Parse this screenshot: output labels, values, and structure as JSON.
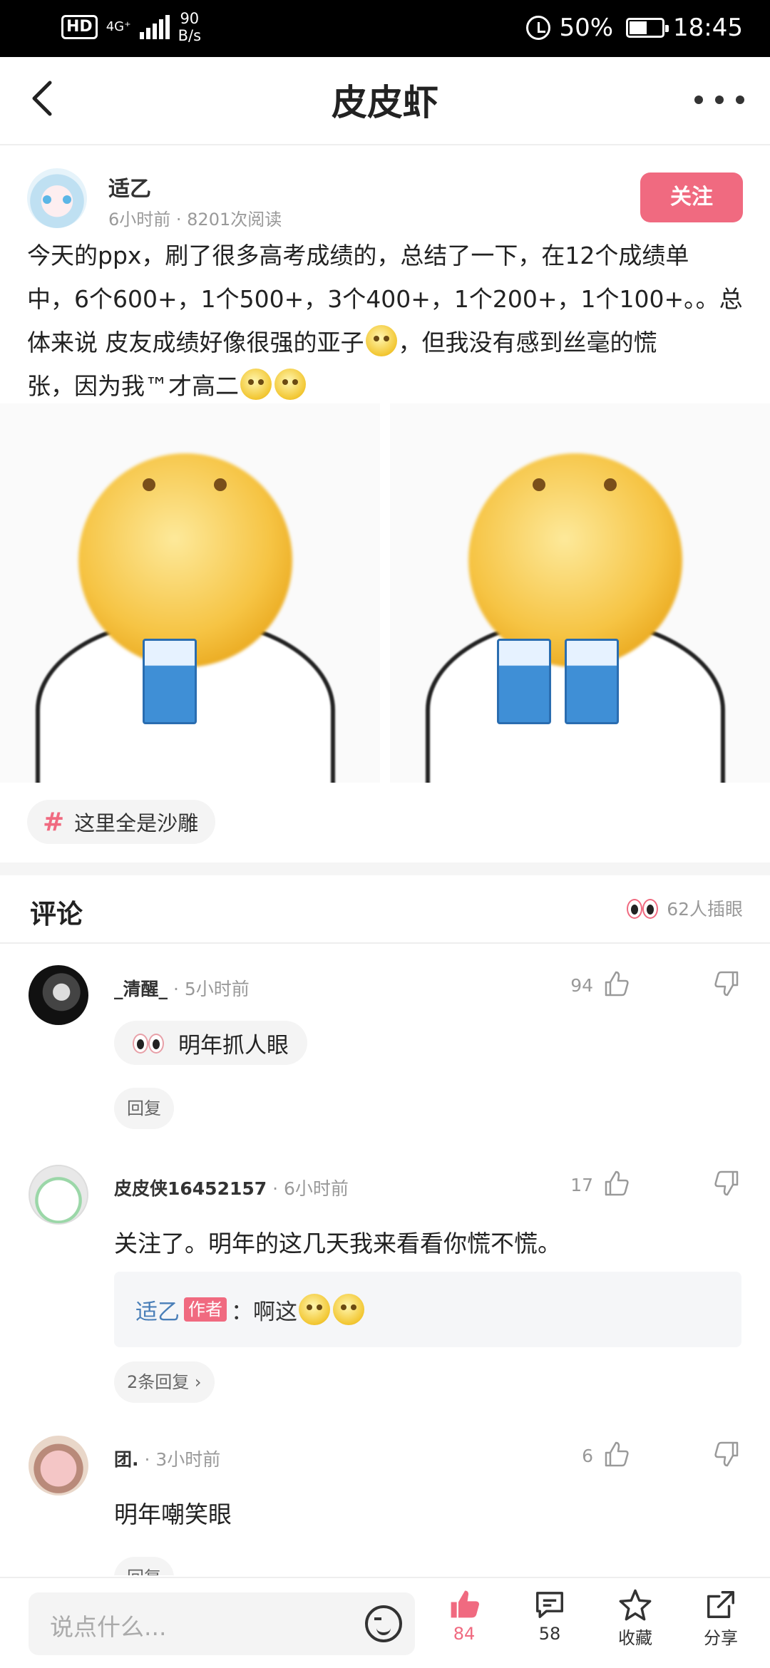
{
  "status_bar": {
    "hd": "HD",
    "network": "4G⁺",
    "speed_value": "90",
    "speed_unit": "B/s",
    "battery": "50%",
    "time": "18:45"
  },
  "nav": {
    "back_icon": "chevron-left-icon",
    "title": "皮皮虾",
    "more_icon": "more-horizontal-icon"
  },
  "post": {
    "author": "适乙",
    "meta": "6小时前 · 8201次阅读",
    "follow_label": "关注",
    "text_line1": "今天的ppx，刷了很多高考成绩的，总结了一下，在12个成绩单",
    "text_line2": "中，6个600+，1个500+，3个400+，1个200+，1个100+。。总",
    "text_line3": "体来说 皮友成绩好像很强的亚子",
    "text_line3b": "，但我没有感到丝毫的慌",
    "text_line4": "张，因为我™才高二",
    "tag": "这里全是沙雕"
  },
  "comments_section": {
    "title": "评论",
    "peek_count": "62人插眼"
  },
  "comments": [
    {
      "name": "_清醒_",
      "time": " · 5小时前",
      "likes": "94",
      "text": "明年抓人眼",
      "reply_label": "回复"
    },
    {
      "name": "皮皮侠16452157",
      "time": " · 6小时前",
      "likes": "17",
      "text": "关注了。明年的这几天我来看看你慌不慌。",
      "quote_name": "适乙",
      "quote_badge": "作者",
      "quote_text": "：啊这",
      "reply_label": "2条回复 ›"
    },
    {
      "name": "团.",
      "time": " · 3小时前",
      "likes": "6",
      "text": "明年嘲笑眼",
      "reply_label": "回复"
    }
  ],
  "bottom_bar": {
    "input_placeholder": "说点什么...",
    "like_count": "84",
    "comment_count": "58",
    "favorite_label": "收藏",
    "share_label": "分享"
  },
  "colors": {
    "accent": "#f06a80",
    "link": "#4a7fb8"
  }
}
